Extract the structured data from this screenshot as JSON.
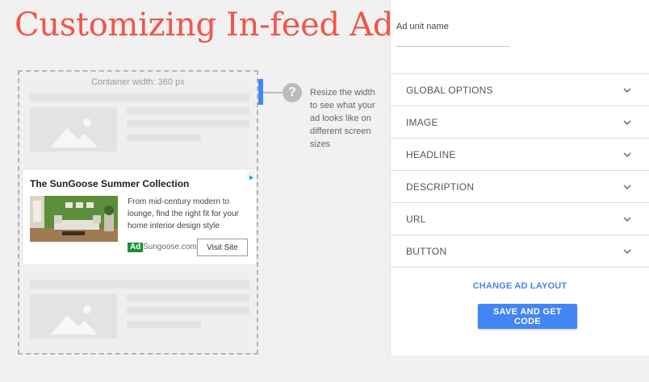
{
  "page_title": "Customizing In-feed Ad",
  "preview": {
    "container_width_label": "Container width: 360 px",
    "help_text": "Resize the width to see what your ad looks like on different screen sizes",
    "help_icon": "question-mark-icon",
    "help_icon_glyph": "?"
  },
  "ad": {
    "headline": "The SunGoose Summer Collection",
    "description": "From mid-century modern to lounge, find the right fit for your home interior design style",
    "badge": "Ad",
    "domain": "Sungoose.com",
    "cta": "Visit Site"
  },
  "panel": {
    "ad_unit_label": "Ad unit name",
    "ad_unit_value": "",
    "sections": [
      {
        "label": "GLOBAL OPTIONS"
      },
      {
        "label": "IMAGE"
      },
      {
        "label": "HEADLINE"
      },
      {
        "label": "DESCRIPTION"
      },
      {
        "label": "URL"
      },
      {
        "label": "BUTTON"
      }
    ],
    "change_layout_label": "CHANGE AD LAYOUT",
    "save_label": "SAVE AND GET CODE"
  },
  "colors": {
    "title": "#f0564a",
    "accent": "#4285f4",
    "ad_badge": "#1e8e3e"
  }
}
